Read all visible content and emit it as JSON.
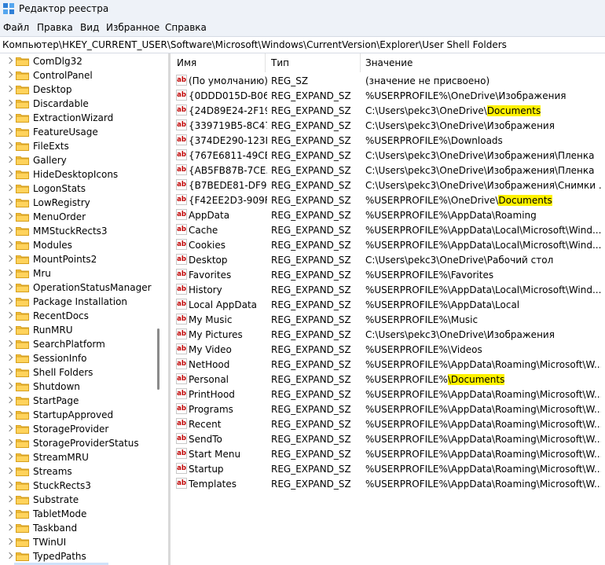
{
  "window": {
    "title": "Редактор реестра"
  },
  "menu": [
    "Файл",
    "Правка",
    "Вид",
    "Избранное",
    "Справка"
  ],
  "address": "Компьютер\\HKEY_CURRENT_USER\\Software\\Microsoft\\Windows\\CurrentVersion\\Explorer\\User Shell Folders",
  "tree": [
    "ComDlg32",
    "ControlPanel",
    "Desktop",
    "Discardable",
    "ExtractionWizard",
    "FeatureUsage",
    "FileExts",
    "Gallery",
    "HideDesktopIcons",
    "LogonStats",
    "LowRegistry",
    "MenuOrder",
    "MMStuckRects3",
    "Modules",
    "MountPoints2",
    "Mru",
    "OperationStatusManager",
    "Package Installation",
    "RecentDocs",
    "RunMRU",
    "SearchPlatform",
    "SessionInfo",
    "Shell Folders",
    "Shutdown",
    "StartPage",
    "StartupApproved",
    "StorageProvider",
    "StorageProviderStatus",
    "StreamMRU",
    "Streams",
    "StuckRects3",
    "Substrate",
    "TabletMode",
    "Taskband",
    "TWinUI",
    "TypedPaths"
  ],
  "columns": {
    "name": "Имя",
    "type": "Тип",
    "value": "Значение"
  },
  "icon": "ab",
  "highlight_color": "#fff200",
  "rows": [
    {
      "name": "(По умолчанию)",
      "type": "REG_SZ",
      "value": "(значение не присвоено)"
    },
    {
      "name": "{0DDD015D-B06...",
      "type": "REG_EXPAND_SZ",
      "value": "%USERPROFILE%\\OneDrive\\Изображения"
    },
    {
      "name": "{24D89E24-2F19...",
      "type": "REG_EXPAND_SZ",
      "value": "C:\\Users\\pekc3\\OneDrive\\",
      "highlight": "Documents"
    },
    {
      "name": "{339719B5-8C47...",
      "type": "REG_EXPAND_SZ",
      "value": "C:\\Users\\pekc3\\OneDrive\\Изображения"
    },
    {
      "name": "{374DE290-123F...",
      "type": "REG_EXPAND_SZ",
      "value": "%USERPROFILE%\\Downloads"
    },
    {
      "name": "{767E6811-49CB...",
      "type": "REG_EXPAND_SZ",
      "value": "C:\\Users\\pekc3\\OneDrive\\Изображения\\Пленка"
    },
    {
      "name": "{AB5FB87B-7CE...",
      "type": "REG_EXPAND_SZ",
      "value": "C:\\Users\\pekc3\\OneDrive\\Изображения\\Пленка"
    },
    {
      "name": "{B7BEDE81-DF94...",
      "type": "REG_EXPAND_SZ",
      "value": "C:\\Users\\pekc3\\OneDrive\\Изображения\\Снимки ..."
    },
    {
      "name": "{F42EE2D3-909F...",
      "type": "REG_EXPAND_SZ",
      "value": "%USERPROFILE%\\OneDrive\\",
      "highlight": "Documents"
    },
    {
      "name": "AppData",
      "type": "REG_EXPAND_SZ",
      "value": "%USERPROFILE%\\AppData\\Roaming"
    },
    {
      "name": "Cache",
      "type": "REG_EXPAND_SZ",
      "value": "%USERPROFILE%\\AppData\\Local\\Microsoft\\Wind..."
    },
    {
      "name": "Cookies",
      "type": "REG_EXPAND_SZ",
      "value": "%USERPROFILE%\\AppData\\Local\\Microsoft\\Wind..."
    },
    {
      "name": "Desktop",
      "type": "REG_EXPAND_SZ",
      "value": "C:\\Users\\pekc3\\OneDrive\\Рабочий стол"
    },
    {
      "name": "Favorites",
      "type": "REG_EXPAND_SZ",
      "value": "%USERPROFILE%\\Favorites"
    },
    {
      "name": "History",
      "type": "REG_EXPAND_SZ",
      "value": "%USERPROFILE%\\AppData\\Local\\Microsoft\\Wind..."
    },
    {
      "name": "Local AppData",
      "type": "REG_EXPAND_SZ",
      "value": "%USERPROFILE%\\AppData\\Local"
    },
    {
      "name": "My Music",
      "type": "REG_EXPAND_SZ",
      "value": "%USERPROFILE%\\Music"
    },
    {
      "name": "My Pictures",
      "type": "REG_EXPAND_SZ",
      "value": "C:\\Users\\pekc3\\OneDrive\\Изображения"
    },
    {
      "name": "My Video",
      "type": "REG_EXPAND_SZ",
      "value": "%USERPROFILE%\\Videos"
    },
    {
      "name": "NetHood",
      "type": "REG_EXPAND_SZ",
      "value": "%USERPROFILE%\\AppData\\Roaming\\Microsoft\\W..."
    },
    {
      "name": "Personal",
      "type": "REG_EXPAND_SZ",
      "value": "%USERPROFILE%",
      "highlight": "\\Documents"
    },
    {
      "name": "PrintHood",
      "type": "REG_EXPAND_SZ",
      "value": "%USERPROFILE%\\AppData\\Roaming\\Microsoft\\W..."
    },
    {
      "name": "Programs",
      "type": "REG_EXPAND_SZ",
      "value": "%USERPROFILE%\\AppData\\Roaming\\Microsoft\\W..."
    },
    {
      "name": "Recent",
      "type": "REG_EXPAND_SZ",
      "value": "%USERPROFILE%\\AppData\\Roaming\\Microsoft\\W..."
    },
    {
      "name": "SendTo",
      "type": "REG_EXPAND_SZ",
      "value": "%USERPROFILE%\\AppData\\Roaming\\Microsoft\\W..."
    },
    {
      "name": "Start Menu",
      "type": "REG_EXPAND_SZ",
      "value": "%USERPROFILE%\\AppData\\Roaming\\Microsoft\\W..."
    },
    {
      "name": "Startup",
      "type": "REG_EXPAND_SZ",
      "value": "%USERPROFILE%\\AppData\\Roaming\\Microsoft\\W..."
    },
    {
      "name": "Templates",
      "type": "REG_EXPAND_SZ",
      "value": "%USERPROFILE%\\AppData\\Roaming\\Microsoft\\W..."
    }
  ]
}
